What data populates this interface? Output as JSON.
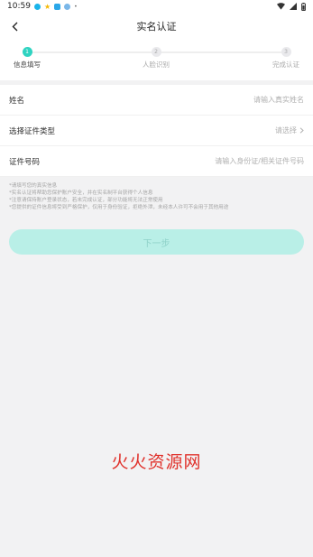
{
  "status_bar": {
    "time": "10:59"
  },
  "nav": {
    "title": "实名认证"
  },
  "steps": [
    {
      "number": "1",
      "label": "信息填写",
      "state": "active"
    },
    {
      "number": "2",
      "label": "人脸识别",
      "state": "pending"
    },
    {
      "number": "3",
      "label": "完成认证",
      "state": "pending"
    }
  ],
  "form": {
    "name": {
      "label": "姓名",
      "placeholder": "请输入真实姓名"
    },
    "id_type": {
      "label": "选择证件类型",
      "value": "请选择"
    },
    "id_number": {
      "label": "证件号码",
      "placeholder": "请输入身份证/相关证件号码"
    }
  },
  "notes": [
    "*请填写您的真实信息",
    "*实名认证将帮助您保护账户安全，并在实名制平台获得个人信息",
    "*注意请保持账户登录状态，若未完成认证，部分功能将无法正常使用",
    "*您提供的证件信息将受到严格保护，仅用于身份验证，拒绝外泄，未经本人许可不会用于其他用途"
  ],
  "next_button": {
    "label": "下一步"
  },
  "watermark": "火火资源网",
  "colors": {
    "accent": "#2fd3c1",
    "button_disabled": "#b9efe7",
    "watermark": "#e0312b"
  }
}
